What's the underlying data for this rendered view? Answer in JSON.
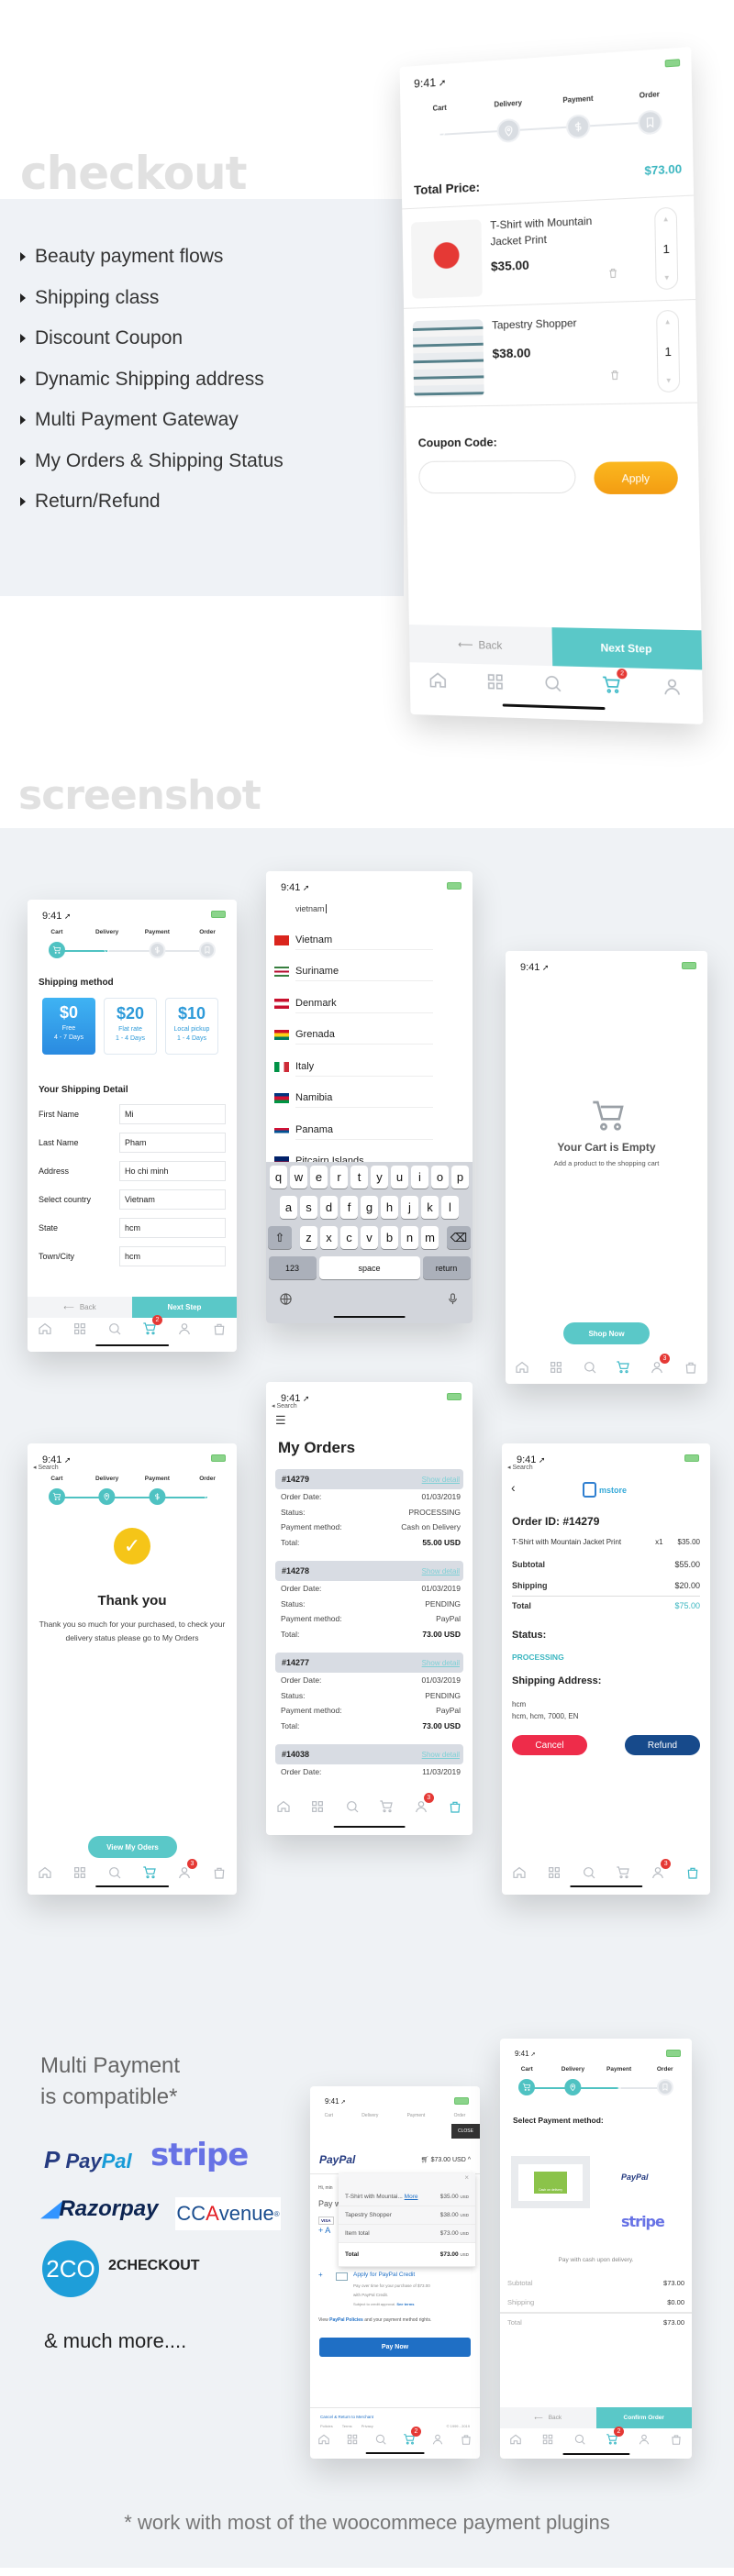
{
  "checkout": {
    "heading": "checkout",
    "features": [
      "Beauty payment flows",
      "Shipping class",
      " Discount Coupon",
      "Dynamic Shipping address",
      "Multi Payment Gateway",
      "My Orders & Shipping Status",
      "Return/Refund"
    ]
  },
  "cart_screen": {
    "time": "9:41",
    "steps": [
      "Cart",
      "Delivery",
      "Payment",
      "Order"
    ],
    "step_states": [
      "current",
      "todo",
      "todo",
      "todo"
    ],
    "total_label": "Total Price:",
    "total_value": "$73.00",
    "items": [
      {
        "name": "T-Shirt with Mountain Jacket Print",
        "price": "$35.00",
        "qty": "1"
      },
      {
        "name": "Tapestry Shopper",
        "price": "$38.00",
        "qty": "1"
      }
    ],
    "coupon_label": "Coupon Code:",
    "coupon_value": "",
    "apply": "Apply",
    "back": "Back",
    "next": "Next Step",
    "nav": {
      "icons": [
        "home",
        "grid",
        "search",
        "cart",
        "user"
      ],
      "active": "cart",
      "badge_on": "cart",
      "badge": "2"
    }
  },
  "screenshot_heading": "screenshot",
  "shipping_screen": {
    "time": "9:41",
    "steps": [
      "Cart",
      "Delivery",
      "Payment",
      "Order"
    ],
    "step_states": [
      "done",
      "current",
      "todo",
      "todo"
    ],
    "method_title": "Shipping method",
    "methods": [
      {
        "price": "$0",
        "name": "Free",
        "days": "4 - 7 Days",
        "selected": true
      },
      {
        "price": "$20",
        "name": "Flat rate",
        "days": "1 - 4 Days",
        "selected": false
      },
      {
        "price": "$10",
        "name": "Local pickup",
        "days": "1 - 4 Days",
        "selected": false
      }
    ],
    "detail_title": "Your Shipping Detail",
    "fields": [
      {
        "label": "First Name",
        "value": "Mi"
      },
      {
        "label": "Last Name",
        "value": "Pham"
      },
      {
        "label": "Address",
        "value": "Ho chi minh"
      },
      {
        "label": "Select country",
        "value": "Vietnam"
      },
      {
        "label": "State",
        "value": "hcm"
      },
      {
        "label": "Town/City",
        "value": "hcm"
      }
    ],
    "back": "Back",
    "next": "Next Step",
    "nav": {
      "icons": [
        "home",
        "grid",
        "search",
        "cart",
        "user",
        "bag"
      ],
      "active": "cart",
      "badge_on": "cart",
      "badge": "2"
    }
  },
  "country_screen": {
    "time": "9:41",
    "search_value": "vietnam",
    "countries": [
      {
        "name": "Vietnam",
        "colors": [
          "#da251d",
          "#da251d"
        ]
      },
      {
        "name": "Suriname",
        "colors": [
          "#377e3f",
          "#ffffff",
          "#b40a2d",
          "#ffffff",
          "#377e3f"
        ]
      },
      {
        "name": "Denmark",
        "colors": [
          "#c8102e",
          "#ffffff",
          "#c8102e"
        ]
      },
      {
        "name": "Grenada",
        "colors": [
          "#ce1126",
          "#fcd116",
          "#007a5e"
        ]
      },
      {
        "name": "Italy",
        "colors": [
          "#009246",
          "#ffffff",
          "#ce2b37"
        ],
        "vertical": true
      },
      {
        "name": "Namibia",
        "colors": [
          "#003580",
          "#d21034",
          "#009543"
        ]
      },
      {
        "name": "Panama",
        "colors": [
          "#ffffff",
          "#d21034",
          "#005293",
          "#ffffff"
        ]
      },
      {
        "name": "Pitcairn Islands",
        "colors": [
          "#012169",
          "#c8102e"
        ]
      }
    ],
    "keyboard": {
      "rows": [
        [
          "q",
          "w",
          "e",
          "r",
          "t",
          "y",
          "u",
          "i",
          "o",
          "p"
        ],
        [
          "a",
          "s",
          "d",
          "f",
          "g",
          "h",
          "j",
          "k",
          "l"
        ],
        [
          "z",
          "x",
          "c",
          "v",
          "b",
          "n",
          "m"
        ]
      ],
      "numbers": "123",
      "space": "space",
      "return": "return"
    }
  },
  "empty_screen": {
    "time": "9:41",
    "title": "Your Cart is Empty",
    "subtitle": "Add a product to the shopping cart",
    "button": "Shop Now",
    "nav": {
      "icons": [
        "home",
        "grid",
        "search",
        "cart",
        "user",
        "bag"
      ],
      "active": "cart",
      "badge_on": "user",
      "badge": "3"
    }
  },
  "thankyou_screen": {
    "time": "9:41",
    "back_label": "Search",
    "steps": [
      "Cart",
      "Delivery",
      "Payment",
      "Order"
    ],
    "step_states": [
      "done",
      "done",
      "done",
      "current"
    ],
    "title": "Thank you",
    "message": "Thank you so much for your purchased, to check your delivery status please go to My Orders",
    "button": "View My Oders",
    "nav": {
      "icons": [
        "home",
        "grid",
        "search",
        "cart",
        "user",
        "bag"
      ],
      "active": "cart",
      "badge_on": "user",
      "badge": "3"
    }
  },
  "orders_screen": {
    "time": "9:41",
    "back_label": "Search",
    "title": "My Orders",
    "labels": {
      "date": "Order Date:",
      "status": "Status:",
      "method": "Payment method:",
      "total": "Total:"
    },
    "orders": [
      {
        "id": "#14279",
        "link": "Show detail",
        "date": "01/03/2019",
        "status": "PROCESSING",
        "method": "Cash on Delivery",
        "total": "55.00 USD"
      },
      {
        "id": "#14278",
        "link": "Show detail",
        "date": "01/03/2019",
        "status": "PENDING",
        "method": "PayPal",
        "total": "73.00 USD"
      },
      {
        "id": "#14277",
        "link": "Show detail",
        "date": "01/03/2019",
        "status": "PENDING",
        "method": "PayPal",
        "total": "73.00 USD"
      },
      {
        "id": "#14038",
        "link": "Show detail",
        "date": "11/03/2019"
      }
    ],
    "nav": {
      "icons": [
        "home",
        "grid",
        "search",
        "cart",
        "user",
        "bag"
      ],
      "active": "bag",
      "badge_on": "user",
      "badge": "3"
    }
  },
  "detail_screen": {
    "time": "9:41",
    "back_label": "Search",
    "logo": "mstore",
    "order_id": "Order ID: #14279",
    "item": {
      "name": "T-Shirt with Mountain Jacket Print",
      "qty": "x1",
      "price": "$35.00"
    },
    "subtotal": {
      "label": "Subtotal",
      "value": "$55.00"
    },
    "shipping": {
      "label": "Shipping",
      "value": "$20.00"
    },
    "total": {
      "label": "Total",
      "value": "$75.00"
    },
    "status_label": "Status:",
    "status": "PROCESSING",
    "address_label": "Shipping Address:",
    "address_lines": [
      "hcm",
      "hcm, hcm, 7000, EN"
    ],
    "cancel": "Cancel",
    "refund": "Refund",
    "nav": {
      "icons": [
        "home",
        "grid",
        "search",
        "cart",
        "user",
        "bag"
      ],
      "active": "bag",
      "badge_on": "user",
      "badge": "3"
    }
  },
  "payments": {
    "title_line1": "Multi Payment",
    "title_line2": "is compatible*",
    "logos": [
      "PayPal",
      "stripe",
      "Razorpay",
      "CCAvenue",
      "2CO",
      "2CHECKOUT"
    ],
    "more": "& much more....",
    "footnote": "* work with most of the woocommece payment plugins"
  },
  "paypal_screen": {
    "time": "9:41",
    "steps": [
      "Cart",
      "Delivery",
      "Payment",
      "Order"
    ],
    "close": "CLOSE",
    "logo": "PayPal",
    "amount": "$73.00 USD",
    "greeting": "Hi, min",
    "pay_with": "Pay w",
    "visa": "VISA",
    "add": "A",
    "dropdown": [
      {
        "name": "T-Shirt with Mountai...",
        "more": "More",
        "price": "$35.00",
        "cur": "USD"
      },
      {
        "name": "Tapestry Shopper",
        "price": "$38.00",
        "cur": "USD"
      },
      {
        "name": "Item total",
        "price": "$73.00",
        "cur": "USD"
      },
      {
        "name": "Total",
        "price": "$73.00",
        "cur": "USD"
      }
    ],
    "credit_title": "Apply for PayPal Credit",
    "credit_lines": [
      "Pay over time for your purchase of $73.00",
      "with PayPal Credit."
    ],
    "credit_terms": "Subject to credit approval.",
    "see_terms": "See terms",
    "policies_pre": "View ",
    "policies_link": "PayPal Policies",
    "policies_post": " and your payment method rights.",
    "pay_now": "Pay Now",
    "cancel_link": "Cancel & Return to Merchant",
    "footer_links": [
      "Policies",
      "Terms",
      "Privacy"
    ],
    "copyright": "© 1999 - 2019",
    "nav": {
      "icons": [
        "home",
        "grid",
        "search",
        "cart",
        "user",
        "bag"
      ],
      "active": "cart",
      "badge_on": "cart",
      "badge": "2"
    }
  },
  "select_screen": {
    "time": "9:41",
    "steps": [
      "Cart",
      "Delivery",
      "Payment",
      "Order"
    ],
    "step_states": [
      "done",
      "done",
      "current",
      "todo"
    ],
    "title": "Select Payment method:",
    "cod_label": "Cash on delivery",
    "paypal": "PayPal",
    "stripe": "stripe",
    "note": "Pay with cash upon delivery.",
    "summary": [
      {
        "label": "Subtotal",
        "value": "$73.00"
      },
      {
        "label": "Shipping",
        "value": "$0.00"
      },
      {
        "label": "Total",
        "value": "$73.00"
      }
    ],
    "back": "Back",
    "confirm": "Confirm Order",
    "nav": {
      "icons": [
        "home",
        "grid",
        "search",
        "cart",
        "user",
        "bag"
      ],
      "active": "cart",
      "badge_on": "cart",
      "badge": "2"
    }
  },
  "colors": {
    "teal": "#4fc2c2",
    "orange": "#f7a81b",
    "blue": "#2a8ae0",
    "red": "#ee2c4a",
    "navy": "#174a8b",
    "paypal_blue": "#1f6fc5"
  }
}
